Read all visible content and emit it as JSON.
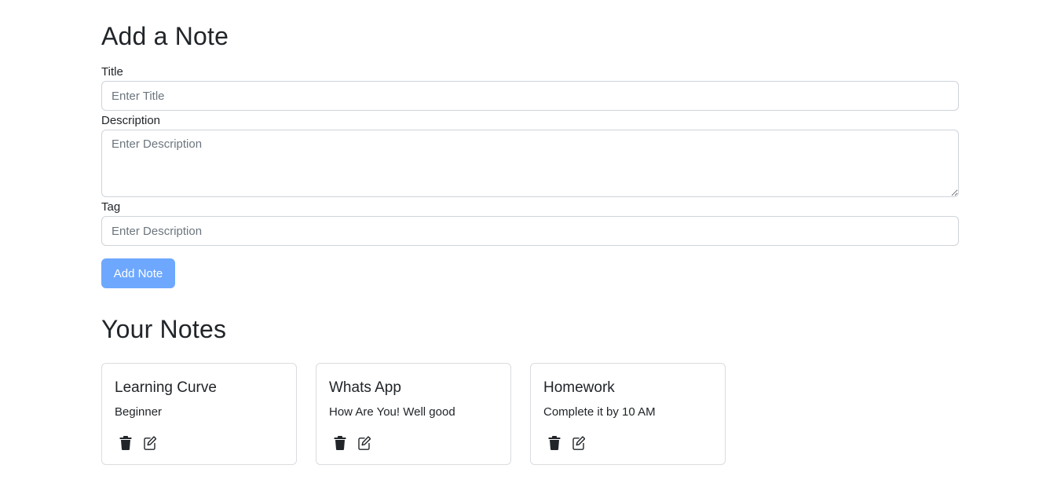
{
  "form": {
    "heading": "Add a Note",
    "title_label": "Title",
    "title_placeholder": "Enter Title",
    "description_label": "Description",
    "description_placeholder": "Enter Description",
    "tag_label": "Tag",
    "tag_placeholder": "Enter Description",
    "submit_label": "Add Note",
    "submit_color": "#6ea8fe"
  },
  "notes_section": {
    "heading": "Your Notes",
    "notes": [
      {
        "title": "Learning Curve",
        "description": "Beginner",
        "icons": [
          "trash-icon",
          "edit-icon"
        ]
      },
      {
        "title": "Whats App",
        "description": "How Are You! Well good",
        "icons": [
          "trash-icon",
          "edit-icon"
        ]
      },
      {
        "title": "Homework",
        "description": "Complete it by 10 AM",
        "icons": [
          "trash-icon",
          "edit-icon"
        ]
      }
    ]
  }
}
